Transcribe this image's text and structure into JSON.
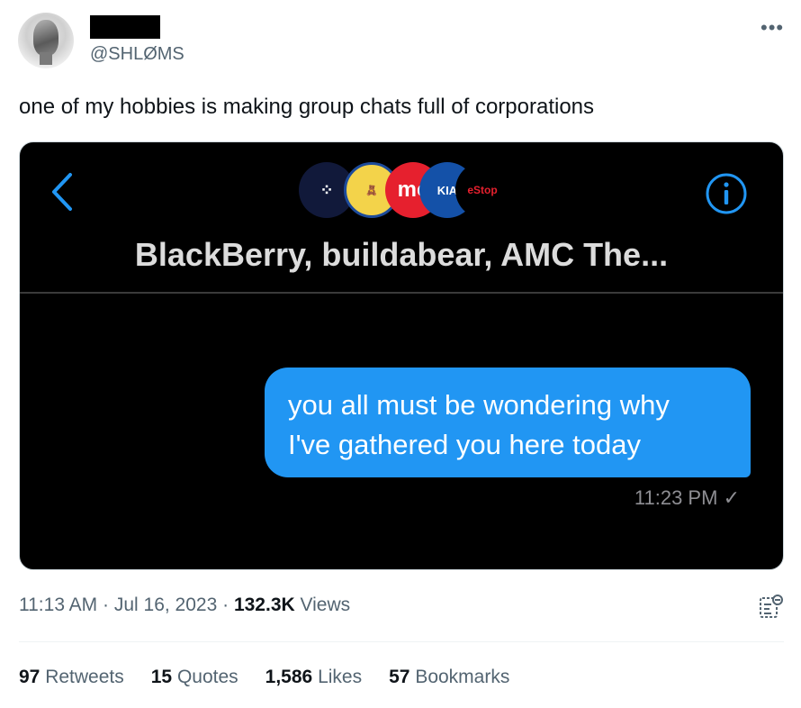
{
  "tweet": {
    "handle": "@SHLØMS",
    "text": "one of my hobbies is making group chats full of corporations",
    "time": "11:13 AM",
    "date": "Jul 16, 2023",
    "views_count": "132.3K",
    "views_label": "Views"
  },
  "media": {
    "chat_title": "BlackBerry, buildabear, AMC The...",
    "message_line1": "you all must be wondering why",
    "message_line2": "I've gathered you here today",
    "message_time": "11:23 PM",
    "logos": {
      "amc": "mc",
      "nokia": "KIA",
      "gamestop": "eStop"
    }
  },
  "stats": [
    {
      "count": "97",
      "label": "Retweets"
    },
    {
      "count": "15",
      "label": "Quotes"
    },
    {
      "count": "1,586",
      "label": "Likes"
    },
    {
      "count": "57",
      "label": "Bookmarks"
    }
  ],
  "colors": {
    "accent": "#2196f3",
    "muted": "#536471"
  }
}
